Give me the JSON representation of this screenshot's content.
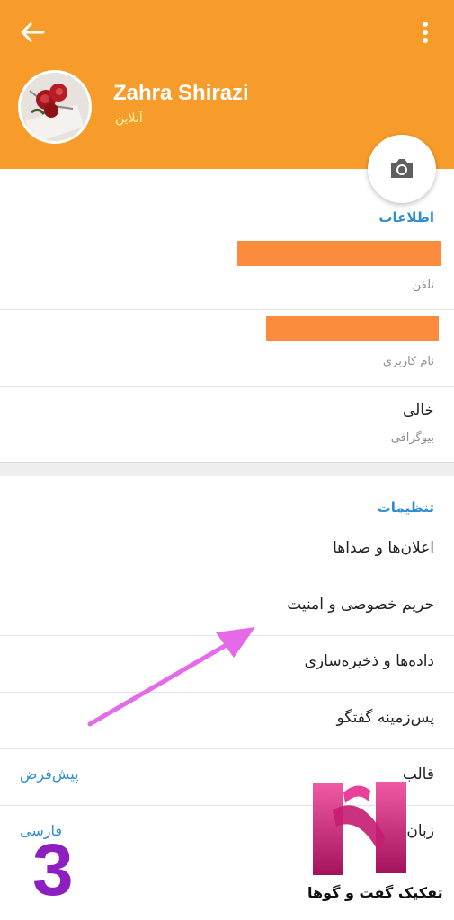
{
  "header": {
    "name": "Zahra Shirazi",
    "status": "آنلاین",
    "back_icon": "arrow-left-icon",
    "menu_icon": "more-vertical-icon",
    "accent_color": "#f79c2a"
  },
  "camera_button": {
    "icon": "camera-icon"
  },
  "info": {
    "title": "اطلاعات",
    "phone_caption": "تلفن",
    "username_caption": "نام کاربری",
    "bio_value": "خالی",
    "bio_caption": "بیوگرافی"
  },
  "settings": {
    "title": "تنظیمات",
    "items": [
      {
        "label": "اعلان‌ها و صداها",
        "value": ""
      },
      {
        "label": "حریم خصوصی و امنیت",
        "value": ""
      },
      {
        "label": "داده‌ها و ذخیره‌سازی",
        "value": ""
      },
      {
        "label": "پس‌زمینه گفتگو",
        "value": ""
      },
      {
        "label": "قالب",
        "value": "پیش‌فرض"
      },
      {
        "label": "زبان",
        "value": "فارسی"
      }
    ]
  },
  "overlay": {
    "step_number": "3",
    "watermark_text": "تفکیک گفت و گوها",
    "arrow_color": "#e46ae8"
  }
}
